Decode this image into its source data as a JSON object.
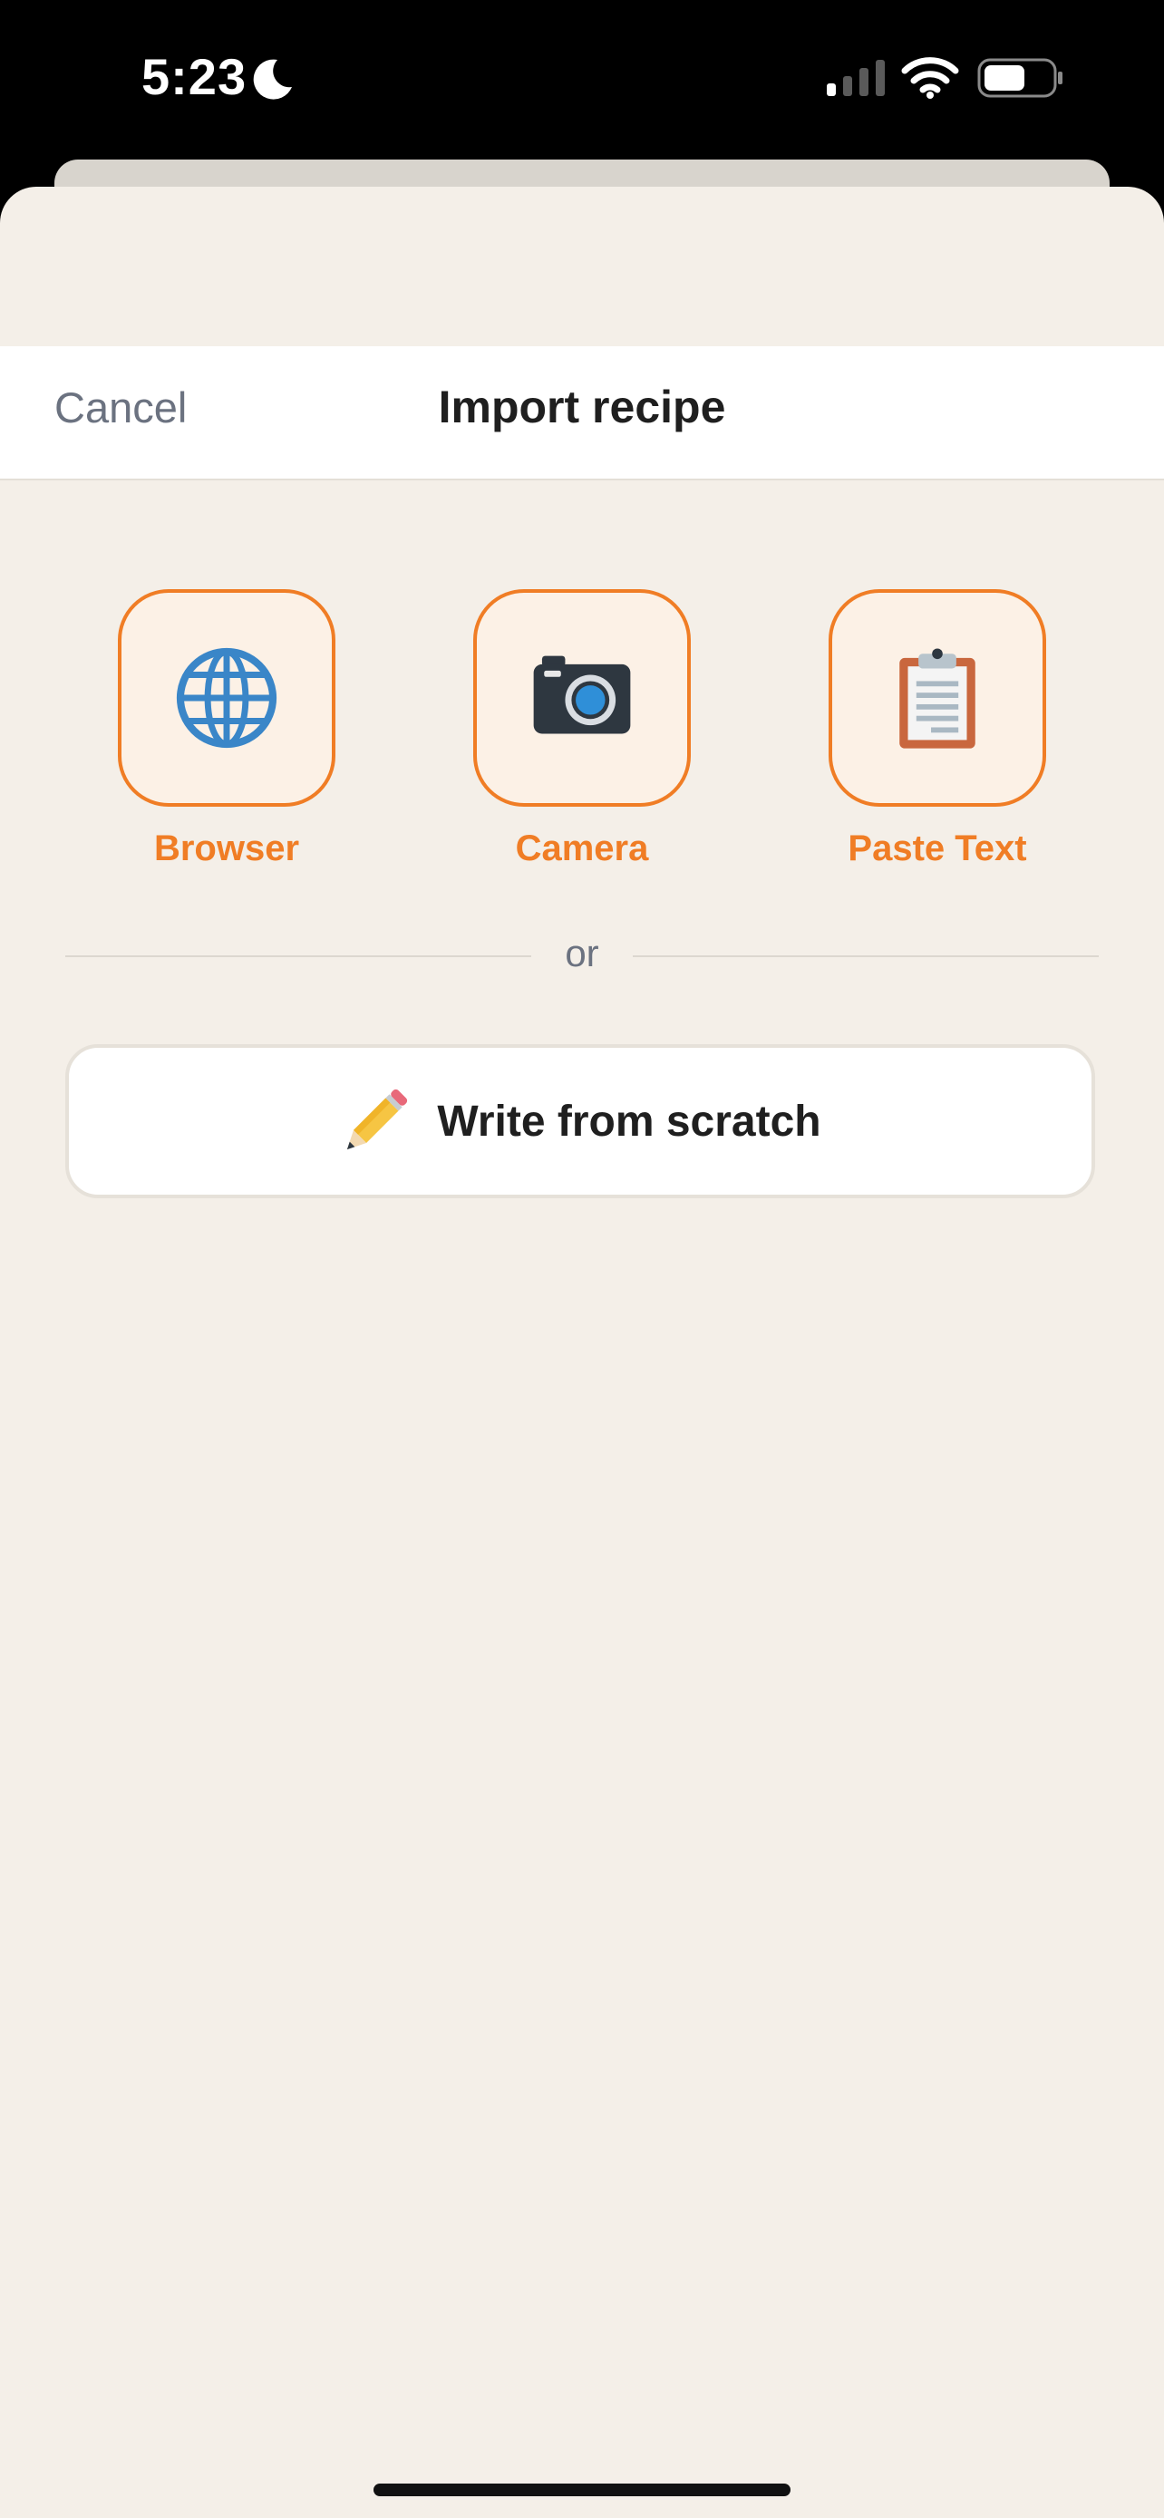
{
  "status_bar": {
    "time": "5:23",
    "icons": [
      "moon-icon",
      "signal-icon",
      "wifi-icon",
      "battery-icon"
    ]
  },
  "nav": {
    "cancel_label": "Cancel",
    "title": "Import recipe"
  },
  "options": [
    {
      "label": "Browser",
      "icon": "globe-icon"
    },
    {
      "label": "Camera",
      "icon": "camera-icon"
    },
    {
      "label": "Paste Text",
      "icon": "clipboard-icon"
    }
  ],
  "divider_text": "or",
  "write_button": {
    "label": "Write from scratch",
    "icon": "pencil-icon"
  },
  "colors": {
    "accent": "#f07d25",
    "tile_background": "#fcf1e6",
    "sheet_background": "#f4efe8",
    "muted_text": "#6b7280"
  }
}
